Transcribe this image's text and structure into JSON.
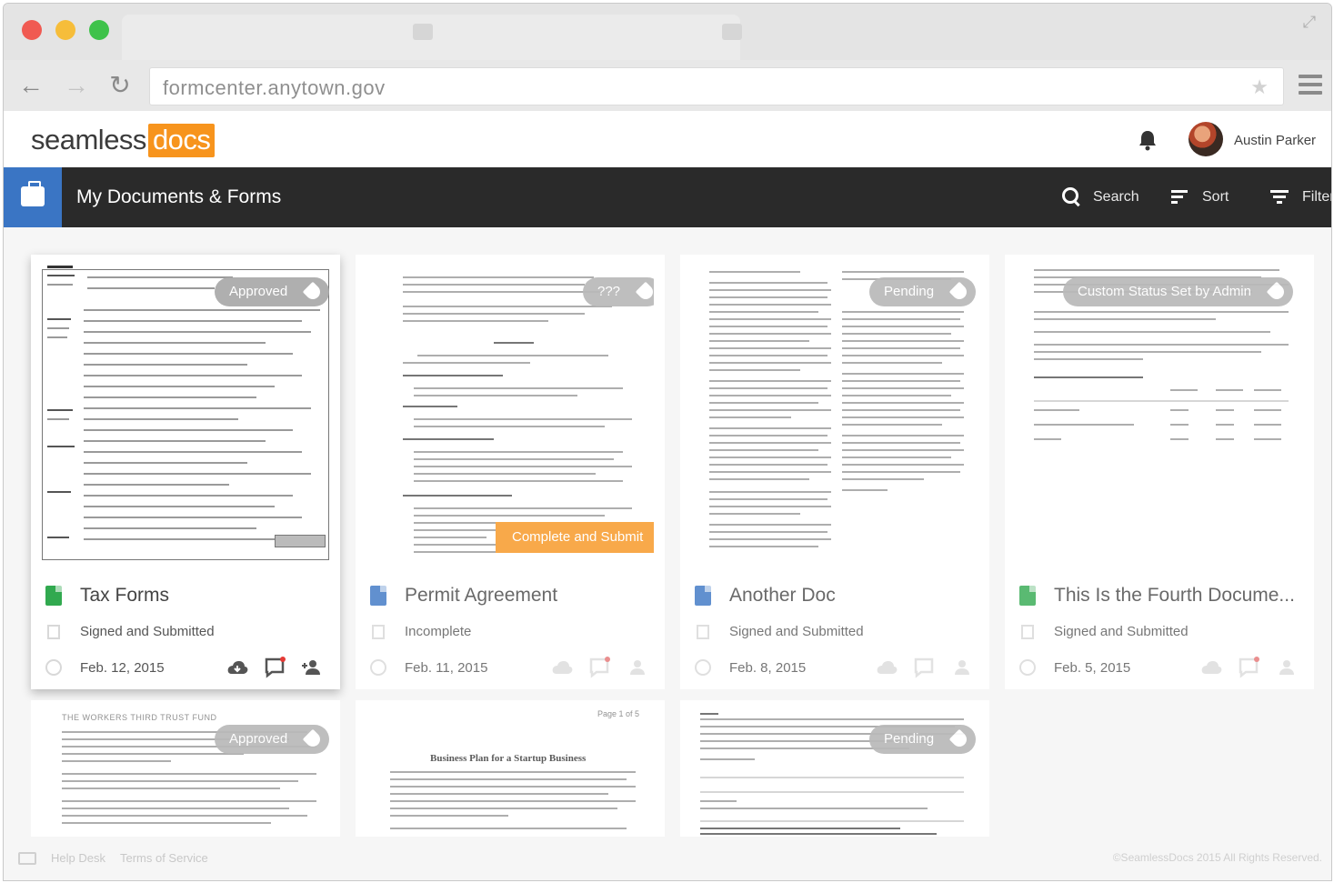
{
  "browser": {
    "url": "formcenter.anytown.gov"
  },
  "header": {
    "logo_main": "seamless",
    "logo_accent": "docs",
    "user_name": "Austin Parker"
  },
  "navbar": {
    "title": "My Documents & Forms",
    "search_label": "Search",
    "sort_label": "Sort",
    "filter_label": "Filter"
  },
  "cards": [
    {
      "title": "Tax Forms",
      "status": "Signed and Submitted",
      "date": "Feb. 12, 2015",
      "badge": "Approved",
      "icon_color": "#31a94f"
    },
    {
      "title": "Permit Agreement",
      "status": "Incomplete",
      "date": "Feb. 11, 2015",
      "badge": "???",
      "cta": "Complete and Submit",
      "icon_color": "#3a75c4"
    },
    {
      "title": "Another Doc",
      "status": "Signed and Submitted",
      "date": "Feb. 8, 2015",
      "badge": "Pending",
      "icon_color": "#3a75c4"
    },
    {
      "title": "This Is the Fourth Docume...",
      "status": "Signed and Submitted",
      "date": "Feb. 5, 2015",
      "badge": "Custom Status Set by Admin",
      "icon_color": "#31a94f"
    }
  ],
  "row2": {
    "card1_header": "THE WORKERS THIRD TRUST FUND",
    "card1_badge": "Approved",
    "card2_page": "Page 1 of 5",
    "card2_heading": "Business Plan for a Startup Business",
    "card3_badge": "Pending"
  },
  "footer": {
    "help": "Help Desk",
    "terms": "Terms of Service",
    "copyright": "©SeamlessDocs 2015 All Rights Reserved."
  },
  "colors": {
    "brand_orange": "#f7941d",
    "brand_blue": "#3a75c4",
    "navbar_bg": "#2a2a2a",
    "badge_gray": "#a9a9a9"
  }
}
